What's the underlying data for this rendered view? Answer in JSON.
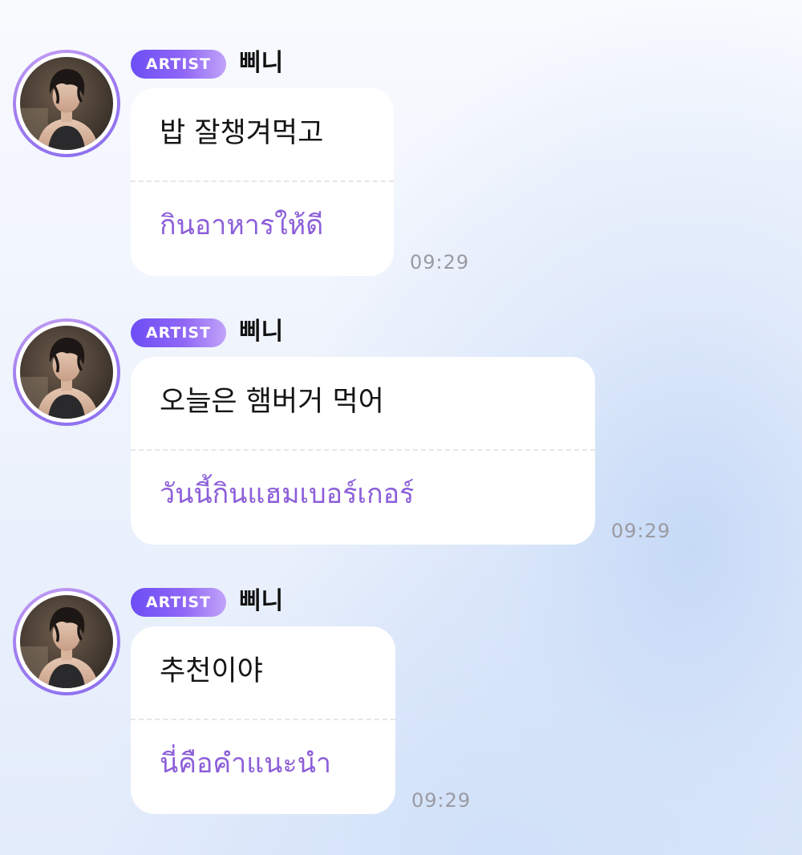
{
  "messages": [
    {
      "badge": "ARTIST",
      "sender": "삐니",
      "text_ko": "밥 잘챙겨먹고",
      "text_th": "กินอาหารให้ดี",
      "time": "09:29"
    },
    {
      "badge": "ARTIST",
      "sender": "삐니",
      "text_ko": "오늘은 햄버거 먹어",
      "text_th": "วันนี้กินแฮมเบอร์เกอร์",
      "time": "09:29"
    },
    {
      "badge": "ARTIST",
      "sender": "삐니",
      "text_ko": "추천이야",
      "text_th": "นี่คือคำแนะนำ",
      "time": "09:29"
    }
  ],
  "colors": {
    "badge_gradient_start": "#6d4ef5",
    "badge_gradient_end": "#c1a3f8",
    "translation_text": "#8c5fd9",
    "bubble": "#ffffff",
    "timestamp": "#9a9aa2",
    "avatar_ring": "#a07df0"
  },
  "icons": {
    "avatar": "profile-photo"
  }
}
